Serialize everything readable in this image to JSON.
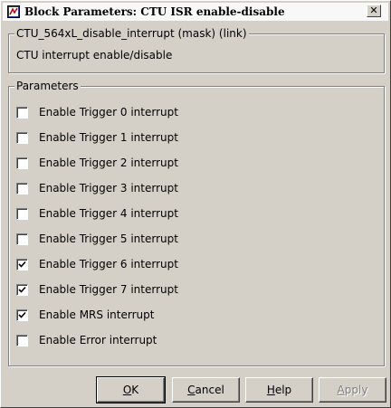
{
  "window": {
    "title": "Block Parameters: CTU ISR enable-disable",
    "close_glyph": "✕"
  },
  "mask": {
    "legend": "CTU_564xL_disable_interrupt (mask) (link)",
    "description": "CTU interrupt enable/disable"
  },
  "params": {
    "legend": "Parameters",
    "items": [
      {
        "label": "Enable Trigger 0 interrupt",
        "checked": false
      },
      {
        "label": "Enable Trigger 1 interrupt",
        "checked": false
      },
      {
        "label": "Enable Trigger 2 interrupt",
        "checked": false
      },
      {
        "label": "Enable Trigger 3 interrupt",
        "checked": false
      },
      {
        "label": "Enable Trigger 4 interrupt",
        "checked": false
      },
      {
        "label": "Enable Trigger 5 interrupt",
        "checked": false
      },
      {
        "label": "Enable Trigger 6 interrupt",
        "checked": true
      },
      {
        "label": "Enable Trigger 7 interrupt",
        "checked": true
      },
      {
        "label": "Enable MRS interrupt",
        "checked": true
      },
      {
        "label": "Enable Error interrupt",
        "checked": false
      }
    ]
  },
  "buttons": {
    "ok": {
      "mnemonic": "O",
      "rest": "K"
    },
    "cancel": {
      "mnemonic": "C",
      "rest": "ancel"
    },
    "help": {
      "mnemonic": "H",
      "rest": "elp"
    },
    "apply": {
      "mnemonic": "A",
      "rest": "pply",
      "enabled": false
    }
  },
  "colors": {
    "dialog_bg": "#d4d0c8",
    "title_bg": "#f8f8f8"
  }
}
